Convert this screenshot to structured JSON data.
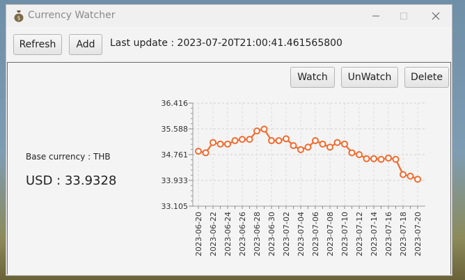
{
  "window": {
    "title": "Currency Watcher",
    "icons": {
      "app": "money-bag-icon",
      "minimize": "minimize-icon",
      "maximize": "maximize-icon",
      "close": "close-icon"
    }
  },
  "toolbar": {
    "refresh_label": "Refresh",
    "add_label": "Add",
    "last_update": "Last update : 2023-07-20T21:00:41.461565800"
  },
  "currency_panel": {
    "watch_label": "Watch",
    "unwatch_label": "UnWatch",
    "delete_label": "Delete",
    "base_currency": "Base currency : THB",
    "rate_text": "USD : 33.9328"
  },
  "chart_data": {
    "type": "line",
    "title": "",
    "xlabel": "",
    "ylabel": "",
    "ylim": [
      33.105,
      36.416
    ],
    "yticks": [
      "33.105",
      "33.933",
      "34.761",
      "35.588",
      "36.416"
    ],
    "xticks": [
      "2023-06-20",
      "2023-06-22",
      "2023-06-24",
      "2023-06-26",
      "2023-06-28",
      "2023-06-30",
      "2023-07-02",
      "2023-07-04",
      "2023-07-06",
      "2023-07-08",
      "2023-07-10",
      "2023-07-12",
      "2023-07-14",
      "2023-07-16",
      "2023-07-18",
      "2023-07-20"
    ],
    "grid": true,
    "legend": "none",
    "color": "#f26a2e",
    "x": [
      "2023-06-20",
      "2023-06-21",
      "2023-06-22",
      "2023-06-23",
      "2023-06-24",
      "2023-06-25",
      "2023-06-26",
      "2023-06-27",
      "2023-06-28",
      "2023-06-29",
      "2023-06-30",
      "2023-07-01",
      "2023-07-02",
      "2023-07-03",
      "2023-07-04",
      "2023-07-05",
      "2023-07-06",
      "2023-07-07",
      "2023-07-08",
      "2023-07-09",
      "2023-07-10",
      "2023-07-11",
      "2023-07-12",
      "2023-07-13",
      "2023-07-14",
      "2023-07-15",
      "2023-07-16",
      "2023-07-17",
      "2023-07-18",
      "2023-07-19",
      "2023-07-20"
    ],
    "values": [
      34.87,
      34.82,
      35.15,
      35.1,
      35.1,
      35.21,
      35.25,
      35.25,
      35.52,
      35.58,
      35.21,
      35.21,
      35.27,
      35.05,
      34.92,
      35.0,
      35.21,
      35.1,
      35.0,
      35.15,
      35.1,
      34.82,
      34.76,
      34.63,
      34.63,
      34.61,
      34.65,
      34.61,
      34.12,
      34.07,
      33.97
    ]
  }
}
